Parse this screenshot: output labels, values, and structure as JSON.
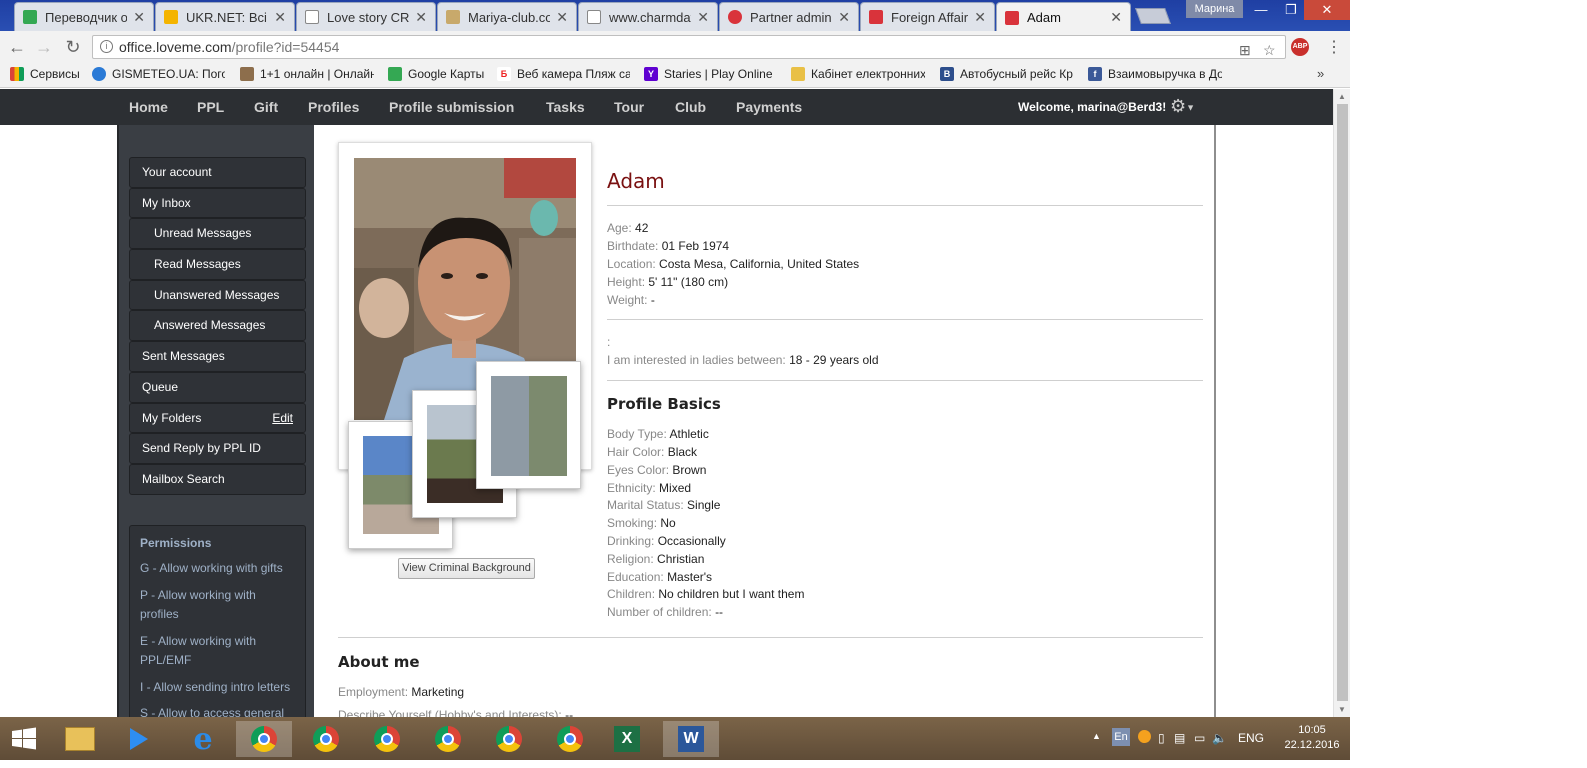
{
  "browser": {
    "tabs": [
      {
        "title": "Переводчик о",
        "fav": "#34a853"
      },
      {
        "title": "UKR.NET: Всі н",
        "fav": "#f4b400"
      },
      {
        "title": "Love story CRM",
        "fav": "#888888"
      },
      {
        "title": "Mariya-club.co",
        "fav": "#c8a96b"
      },
      {
        "title": "www.charmdat",
        "fav": "#888888"
      },
      {
        "title": "Partner admin",
        "fav": "#d9333b"
      },
      {
        "title": "Foreign Affair",
        "fav": "#d9333b"
      },
      {
        "title": "Adam",
        "fav": "#d9333b"
      }
    ],
    "user_button": "Марина",
    "url_host": "office.loveme.com",
    "url_path": "/profile?id=54454",
    "bookmarks": [
      "Сервисы",
      "GISMETEO.UA: Погод",
      "1+1 онлайн | Онлайн",
      "Google Карты",
      "Веб камера Пляж са",
      "Staries | Play Online -",
      "Кабінет електронних",
      "Автобусный рейс Кр",
      "Взаимовыручка в До"
    ]
  },
  "topnav": {
    "links": [
      "Home",
      "PPL",
      "Gift",
      "Profiles",
      "Profile submission",
      "Tasks",
      "Tour",
      "Club",
      "Payments"
    ],
    "welcome": "Welcome, marina@Berd3!"
  },
  "sidebar": {
    "items": [
      {
        "label": "Your account",
        "sub": false
      },
      {
        "label": "My Inbox",
        "sub": false
      },
      {
        "label": "Unread Messages",
        "sub": true
      },
      {
        "label": "Read Messages",
        "sub": true
      },
      {
        "label": "Unanswered Messages",
        "sub": true
      },
      {
        "label": "Answered Messages",
        "sub": true
      },
      {
        "label": "Sent Messages",
        "sub": false
      },
      {
        "label": "Queue",
        "sub": false
      },
      {
        "label": "My Folders",
        "sub": false
      },
      {
        "label": "Send Reply by PPL ID",
        "sub": false
      },
      {
        "label": "Mailbox Search",
        "sub": false
      }
    ],
    "edit_label": "Edit",
    "permissions_title": "Permissions",
    "permissions": [
      "G - Allow working with gifts",
      "P - Allow working with profiles",
      "E - Allow working with PPL/EMF",
      "I - Allow sending intro letters",
      "S - Allow to access general"
    ]
  },
  "profile": {
    "name": "Adam",
    "criminal_button": "View Criminal Background",
    "details": [
      {
        "label": "Age:",
        "value": "42"
      },
      {
        "label": "Birthdate:",
        "value": "01 Feb 1974"
      },
      {
        "label": "Location:",
        "value": "Costa Mesa, California, United States"
      },
      {
        "label": "Height:",
        "value": "5' 11\" (180 cm)"
      },
      {
        "label": "Weight:",
        "value": "-"
      }
    ],
    "colon_line": ":",
    "interest_label": "I am interested in ladies between:",
    "interest_value": "18 - 29 years old",
    "basics_title": "Profile Basics",
    "basics": [
      {
        "label": "Body Type:",
        "value": "Athletic"
      },
      {
        "label": "Hair Color:",
        "value": "Black"
      },
      {
        "label": "Eyes Color:",
        "value": "Brown"
      },
      {
        "label": "Ethnicity:",
        "value": "Mixed"
      },
      {
        "label": "Marital Status:",
        "value": "Single"
      },
      {
        "label": "Smoking:",
        "value": "No"
      },
      {
        "label": "Drinking:",
        "value": "Occasionally"
      },
      {
        "label": "Religion:",
        "value": "Christian"
      },
      {
        "label": "Education:",
        "value": "Master's"
      },
      {
        "label": "Children:",
        "value": "No children but I want them"
      },
      {
        "label": "Number of children:",
        "value": "--"
      }
    ],
    "about_title": "About me",
    "about": [
      {
        "label": "Employment:",
        "value": "Marketing"
      },
      {
        "label": "Describe Yourself (Hobby's and Interests):",
        "value": "--"
      }
    ]
  },
  "taskbar": {
    "lang_indicator": "En",
    "lang": "ENG",
    "time": "10:05",
    "date": "22.12.2016"
  }
}
